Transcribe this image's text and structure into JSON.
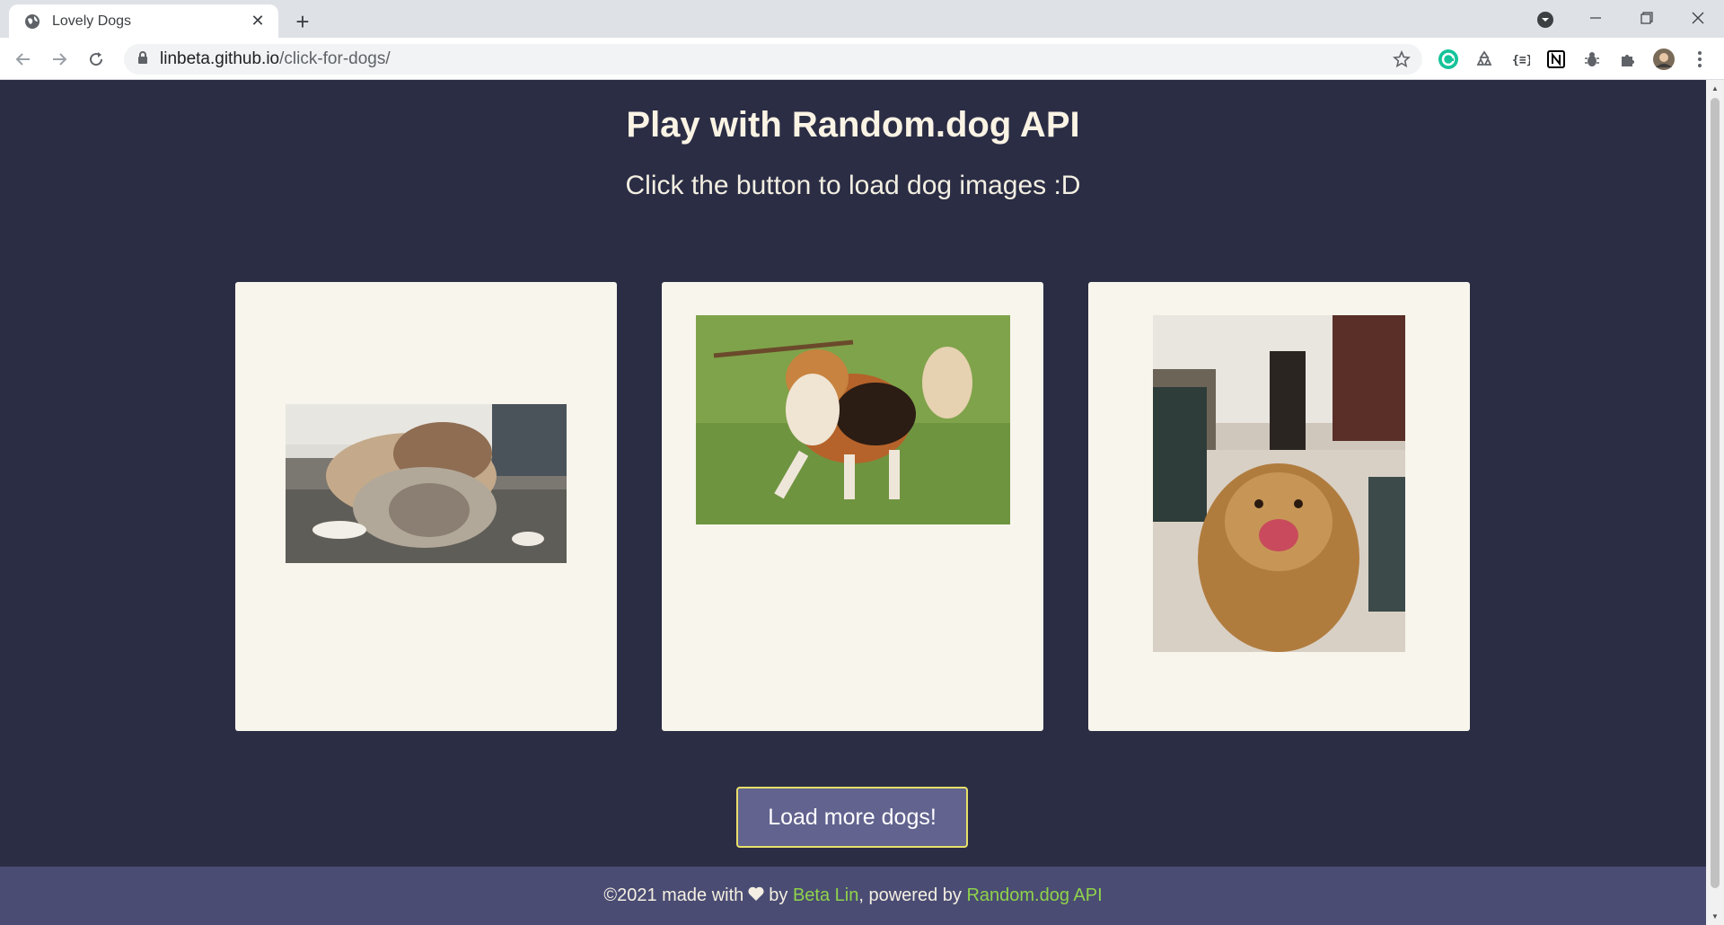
{
  "browser": {
    "tab_title": "Lovely Dogs",
    "url_host": "linbeta.github.io",
    "url_path": "/click-for-dogs/",
    "extensions": [
      "grammarly-icon",
      "recycle-icon",
      "braces-icon",
      "notion-icon",
      "bug-icon",
      "puzzle-icon",
      "avatar"
    ]
  },
  "page": {
    "title": "Play with Random.dog API",
    "subtitle": "Click the button to load dog images :D",
    "button_label": "Load more dogs!"
  },
  "cards": [
    {
      "image_alt": "two fluffy puppies on kitchen floor"
    },
    {
      "image_alt": "tricolor dog carrying a stick on grass"
    },
    {
      "image_alt": "golden retriever licking its nose in dining room"
    }
  ],
  "footer": {
    "prefix": "©2021 made with",
    "by": "by",
    "author": "Beta Lin",
    "powered": ", powered by",
    "api": "Random.dog API"
  },
  "colors": {
    "page_bg": "#2b2d45",
    "card_bg": "#f7f5ec",
    "button_bg": "#62638f",
    "button_border": "#e8e06a",
    "footer_bg": "#4a4c73",
    "link": "#8fd34b"
  }
}
